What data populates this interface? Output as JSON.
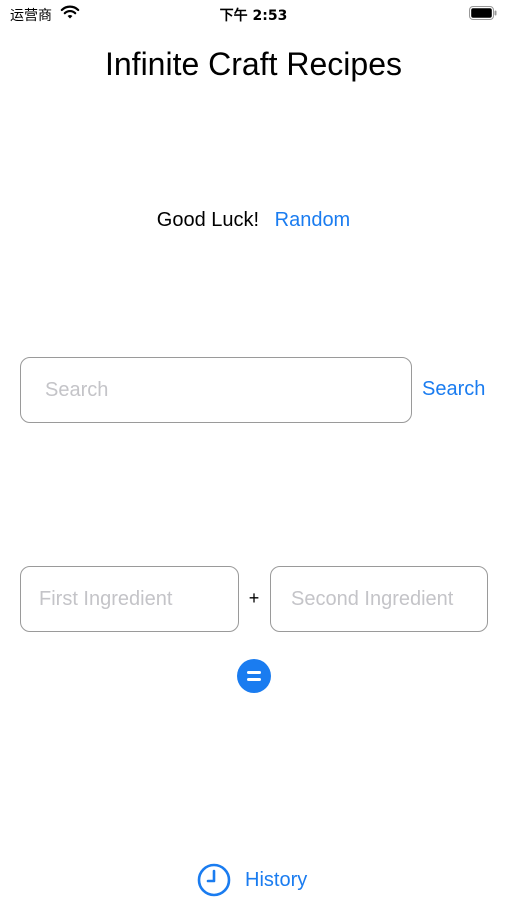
{
  "status_bar": {
    "carrier": "运营商",
    "time": "下午 2:53",
    "wifi_icon": "wifi-icon",
    "battery_icon": "battery-icon"
  },
  "title": "Infinite Craft Recipes",
  "luck": {
    "text": "Good Luck!",
    "random_label": "Random"
  },
  "search": {
    "placeholder": "Search",
    "value": "",
    "button_label": "Search"
  },
  "combine": {
    "first_placeholder": "First Ingredient",
    "second_placeholder": "Second Ingredient",
    "operator": "+",
    "equals_icon": "equals-icon"
  },
  "history": {
    "label": "History",
    "icon": "clock-icon"
  },
  "colors": {
    "accent": "#1a7cf0",
    "border": "#9a9a9a",
    "placeholder": "#c4c4c8",
    "background": "#ffffff"
  }
}
